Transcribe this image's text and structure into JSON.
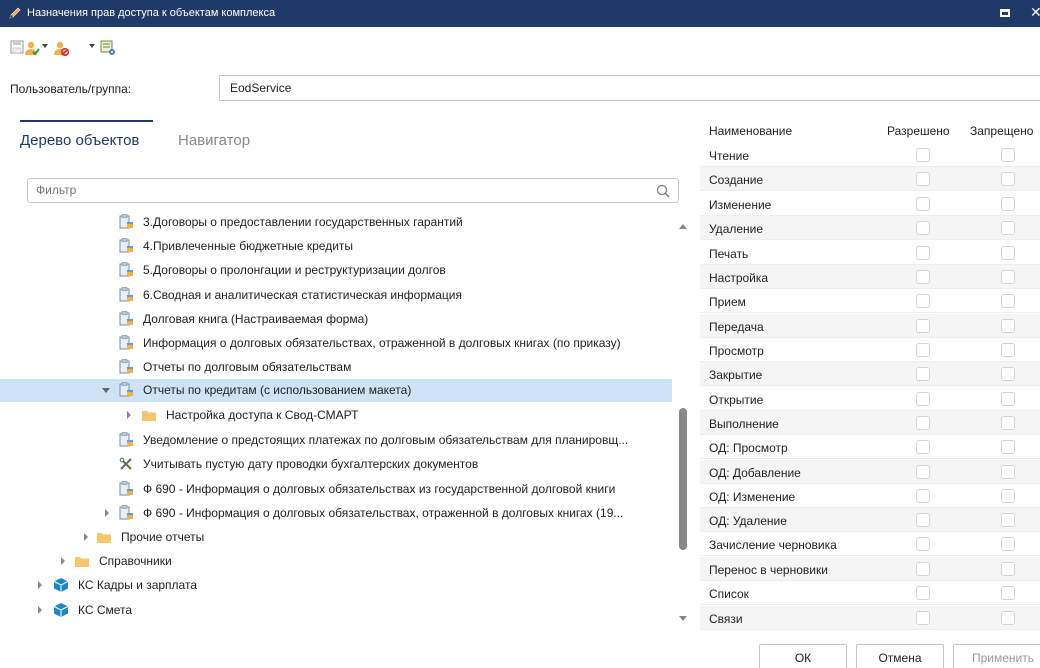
{
  "window": {
    "title": "Назначения прав доступа к объектам комплекса"
  },
  "toolbar": {
    "icons": [
      "save-icon",
      "add-user-icon",
      "remove-user-icon",
      "settings-icon"
    ]
  },
  "user": {
    "label": "Пользователь/группа:",
    "value": "EodService"
  },
  "tabs": [
    {
      "label": "Дерево объектов",
      "active": true
    },
    {
      "label": "Навигатор",
      "active": false
    }
  ],
  "filter": {
    "placeholder": "Фильтр"
  },
  "tree": {
    "items": [
      {
        "label": "3.Договоры о предоставлении государственных гарантий",
        "icon": "report"
      },
      {
        "label": "4.Привлеченные бюджетные кредиты",
        "icon": "report"
      },
      {
        "label": "5.Договоры о пролонгации и реструктуризации долгов",
        "icon": "report"
      },
      {
        "label": "6.Сводная и аналитическая статистическая информация",
        "icon": "report"
      },
      {
        "label": "Долговая книга (Настраиваемая форма)",
        "icon": "report"
      },
      {
        "label": "Информация о долговых обязательствах, отраженной в долговых книгах (по приказу)",
        "icon": "report"
      },
      {
        "label": "Отчеты по долговым обязательствам",
        "icon": "report"
      },
      {
        "label": "Отчеты по кредитам (с использованием макета)",
        "icon": "report",
        "expanded": true,
        "selected": true
      },
      {
        "label": "Настройка доступа к Свод-СМАРТ",
        "icon": "folder",
        "collapsed": true
      },
      {
        "label": "Уведомление о предстоящих платежах по долговым обязательствам для планировщ...",
        "icon": "report"
      },
      {
        "label": "Учитывать пустую дату проводки бухгалтерских документов",
        "icon": "tools"
      },
      {
        "label": "Ф 690 - Информация о долговых обязательствах из государственной долговой книги",
        "icon": "report"
      },
      {
        "label": "Ф 690 - Информация о долговых обязательствах, отраженной в долговых книгах (19...",
        "icon": "report",
        "collapsed": true
      },
      {
        "label": "Прочие отчеты",
        "icon": "folder",
        "collapsed": true
      },
      {
        "label": "Справочники",
        "icon": "folder",
        "collapsed": true
      },
      {
        "label": "КС Кадры и зарплата",
        "icon": "cube",
        "collapsed": true
      },
      {
        "label": "КС Смета",
        "icon": "cube",
        "collapsed": true
      }
    ]
  },
  "permissions": {
    "headers": {
      "name": "Наименование",
      "allowed": "Разрешено",
      "denied": "Запрещено"
    },
    "rows": [
      "Чтение",
      "Создание",
      "Изменение",
      "Удаление",
      "Печать",
      "Настройка",
      "Прием",
      "Передача",
      "Просмотр",
      "Закрытие",
      "Открытие",
      "Выполнение",
      "ОД: Просмотр",
      "ОД: Добавление",
      "ОД: Изменение",
      "ОД: Удаление",
      "Зачисление черновика",
      "Перенос в черновики",
      "Список",
      "Связи"
    ]
  },
  "buttons": {
    "ok": "ОК",
    "cancel": "Отмена",
    "apply": "Применить"
  },
  "colors": {
    "titlebar": "#1f3a68",
    "selection": "#cfe3f7",
    "folder": "#f5c66b",
    "cube": "#1e88c7"
  }
}
